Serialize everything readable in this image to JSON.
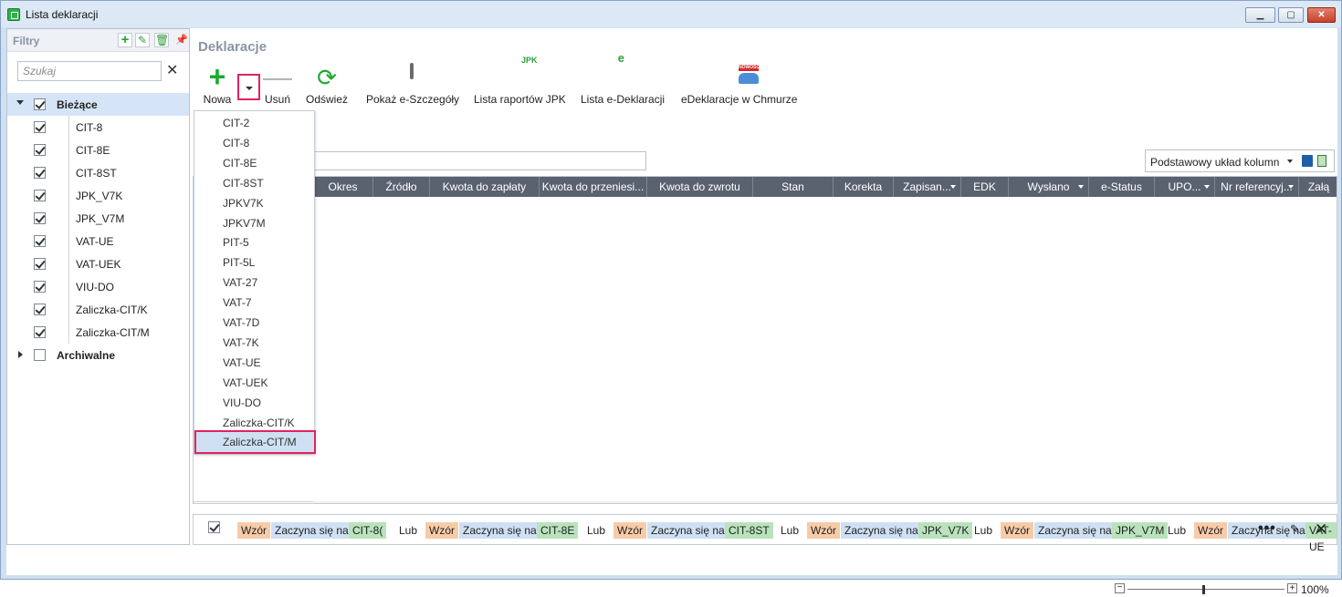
{
  "window": {
    "title": "Lista deklaracji",
    "min_label": "▁",
    "max_label": "▢",
    "close_label": "✕"
  },
  "left_panel": {
    "header": "Filtry",
    "search_placeholder": "Szukaj",
    "groups": [
      {
        "label": "Bieżące",
        "checked": true,
        "expanded": true,
        "items": [
          "CIT-8",
          "CIT-8E",
          "CIT-8ST",
          "JPK_V7K",
          "JPK_V7M",
          "VAT-UE",
          "VAT-UEK",
          "VIU-DO",
          "Zaliczka-CIT/K",
          "Zaliczka-CIT/M"
        ]
      },
      {
        "label": "Archiwalne",
        "checked": false,
        "expanded": false
      }
    ]
  },
  "section_title": "Deklaracje",
  "toolbar": {
    "nowa": "Nowa",
    "usun": "Usuń",
    "odswiez": "Odśwież",
    "pokaz": "Pokaż e-Szczegóły",
    "lista_jpk": "Lista raportów JPK",
    "lista_edekl": "Lista e-Deklaracji",
    "chmura": "eDeklaracje w Chmurze",
    "jpk_badge": "JPK",
    "nowosc_badge": "NOWOŚĆ"
  },
  "layout_selector": {
    "value": "Podstawowy układ kolumn"
  },
  "columns": [
    "Okres",
    "Źródło",
    "Kwota do zapłaty",
    "Kwota do przeniesi...",
    "Kwota do zwrotu",
    "Stan",
    "Korekta",
    "Zapisan...",
    "EDK",
    "Wysłano",
    "e-Status",
    "UPO...",
    "Nr referencyj...",
    "Załą"
  ],
  "dropdown_menu": {
    "items": [
      "CIT-2",
      "CIT-8",
      "CIT-8E",
      "CIT-8ST",
      "JPKV7K",
      "JPKV7M",
      "PIT-5",
      "PIT-5L",
      "VAT-27",
      "VAT-7",
      "VAT-7D",
      "VAT-7K",
      "VAT-UE",
      "VAT-UEK",
      "VIU-DO",
      "Zaliczka-CIT/K",
      "Zaliczka-CIT/M"
    ],
    "highlighted": "Zaliczka-CIT/M"
  },
  "filter_bar": {
    "tokens": [
      {
        "t": "Wzór",
        "k": "w"
      },
      {
        "t": "Zaczyna się na",
        "k": "z"
      },
      {
        "t": "CIT-8(",
        "k": "v"
      },
      {
        "t": "Lub",
        "k": "l"
      },
      {
        "t": "Wzór",
        "k": "w"
      },
      {
        "t": "Zaczyna się na",
        "k": "z"
      },
      {
        "t": "CIT-8E",
        "k": "v"
      },
      {
        "t": "Lub",
        "k": "l"
      },
      {
        "t": "Wzór",
        "k": "w"
      },
      {
        "t": "Zaczyna się na",
        "k": "z"
      },
      {
        "t": "CIT-8ST",
        "k": "v"
      },
      {
        "t": "Lub",
        "k": "l"
      },
      {
        "t": "Wzór",
        "k": "w"
      },
      {
        "t": "Zaczyna się na",
        "k": "z"
      },
      {
        "t": "JPK_V7K",
        "k": "v"
      },
      {
        "t": "Lub",
        "k": "l"
      },
      {
        "t": "Wzór",
        "k": "w"
      },
      {
        "t": "Zaczyna się na",
        "k": "z"
      },
      {
        "t": "JPK_V7M",
        "k": "v"
      },
      {
        "t": "Lub",
        "k": "l"
      },
      {
        "t": "Wzór",
        "k": "w"
      },
      {
        "t": "Zaczyna się na",
        "k": "z"
      },
      {
        "t": "VAT-UE",
        "k": "v"
      }
    ],
    "more": "•••",
    "edit": "✎",
    "close": "✕"
  },
  "zoom": {
    "value": "100%",
    "minus": "−",
    "plus": "+"
  }
}
